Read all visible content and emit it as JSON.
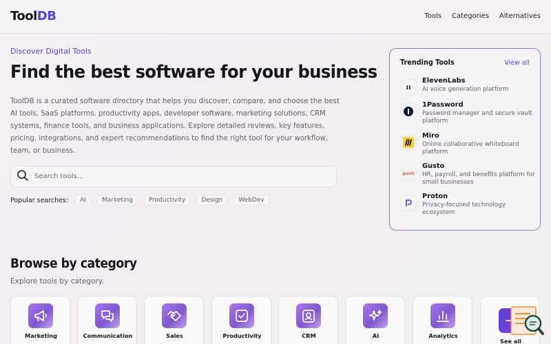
{
  "header": {
    "logo_prefix": "Tool",
    "logo_accent": "DB",
    "nav": [
      "Tools",
      "Categories",
      "Alternatives"
    ]
  },
  "hero": {
    "eyebrow": "Discover Digital Tools",
    "title": "Find the best software for your business",
    "description": "ToolDB is a curated software directory that helps you discover, compare, and choose the best AI tools, SaaS platforms, productivity apps, developer software, marketing solutions, CRM systems, finance tools, and business applications. Explore detailed reviews, key features, pricing, integrations, and expert recommendations to find the right tool for your workflow, team, or business.",
    "search_placeholder": "Search tools...",
    "popular_label": "Popular searches:",
    "popular": [
      "AI",
      "Marketing",
      "Productivity",
      "Design",
      "WebDev"
    ]
  },
  "trending": {
    "title": "Trending Tools",
    "view_all": "View all",
    "items": [
      {
        "name": "ElevenLabs",
        "desc": "AI voice generation platform",
        "icon": "elevenlabs-logo"
      },
      {
        "name": "1Password",
        "desc": "Password manager and secure vault platform",
        "icon": "onepassword-logo"
      },
      {
        "name": "Miro",
        "desc": "Online collaborative whiteboard platform",
        "icon": "miro-logo"
      },
      {
        "name": "Gusto",
        "desc": "HR, payroll, and benefits platform for small businesses",
        "icon": "gusto-logo"
      },
      {
        "name": "Proton",
        "desc": "Privacy-focused technology ecosystem",
        "icon": "proton-logo"
      }
    ]
  },
  "browse": {
    "title": "Browse by category",
    "subtitle": "Explore tools by category.",
    "categories": [
      {
        "label": "Marketing",
        "icon": "megaphone-icon"
      },
      {
        "label": "Communication",
        "icon": "chat-bubbles-icon"
      },
      {
        "label": "Sales",
        "icon": "handshake-icon"
      },
      {
        "label": "Productivity",
        "icon": "checkbox-icon"
      },
      {
        "label": "CRM",
        "icon": "contact-card-icon"
      },
      {
        "label": "AI",
        "icon": "sparkles-icon"
      },
      {
        "label": "Analytics",
        "icon": "bar-chart-icon"
      },
      {
        "label": "See all",
        "icon": "arrow-right-icon"
      }
    ]
  },
  "colors": {
    "accent": "#5a3fd6",
    "card_border": "#8c7fc4",
    "category_icon_gradient": [
      "#a876ee",
      "#7f58cf"
    ]
  }
}
